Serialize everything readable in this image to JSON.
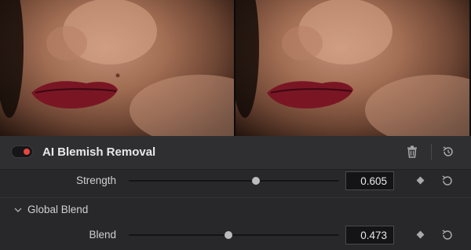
{
  "viewer": {
    "left_image": "face-before",
    "right_image": "face-after"
  },
  "effect": {
    "title": "AI Blemish Removal",
    "enabled": true,
    "enabled_color": "#e8463e",
    "delete_icon": "trash-icon",
    "reset_icon": "reset-icon"
  },
  "params": {
    "strength": {
      "label": "Strength",
      "value": "0.605",
      "level": 0.605
    },
    "blend": {
      "label": "Blend",
      "value": "0.473",
      "level": 0.473
    }
  },
  "groups": {
    "global_blend": {
      "label": "Global Blend",
      "expanded": true
    }
  }
}
